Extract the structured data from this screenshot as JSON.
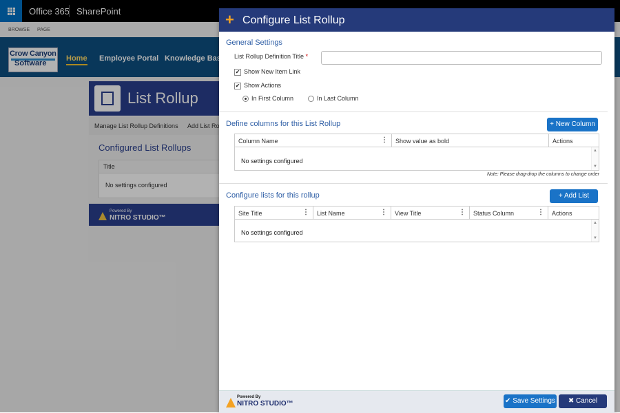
{
  "suitebar": {
    "brand": "Office 365",
    "app": "SharePoint"
  },
  "ribbon": {
    "tabs": [
      "BROWSE",
      "PAGE"
    ]
  },
  "logo": {
    "line1": "Crow Canyon",
    "line2": "Software"
  },
  "nav": {
    "items": [
      "Home",
      "Employee Portal",
      "Knowledge Base"
    ]
  },
  "page": {
    "banner_title": "List Rollup",
    "tabs": [
      "Manage List Rollup Definitions",
      "Add List Ro"
    ],
    "configured_title": "Configured List Rollups",
    "table_header": "Title",
    "empty": "No settings configured",
    "powered_by": "Powered By",
    "nitro": "NITRO STUDIO™"
  },
  "dialog": {
    "title": "Configure List Rollup",
    "general": {
      "heading": "General Settings",
      "title_label": "List Rollup Definition Title",
      "required_mark": "*",
      "title_value": "",
      "show_new_item_link": "Show New Item Link",
      "show_actions": "Show Actions",
      "in_first_column": "In First Column",
      "in_last_column": "In Last Column",
      "check_mark": "✔"
    },
    "columns": {
      "heading": "Define columns for this List Rollup",
      "new_button": "New Column",
      "headers": [
        "Column Name",
        "Show value as bold",
        "Actions"
      ],
      "empty": "No settings configured",
      "note": "Note: Please drag-drop the columns to change order"
    },
    "lists": {
      "heading": "Configure lists for this rollup",
      "add_button": "Add List",
      "headers": [
        "Site Title",
        "List Name",
        "View Title",
        "Status Column",
        "Actions"
      ],
      "empty": "No settings configured"
    },
    "footer": {
      "powered_by": "Powered By",
      "nitro": "NITRO STUDIO™",
      "save": "Save Settings",
      "cancel": "Cancel"
    }
  },
  "colors": {
    "accent": "#1a73c7",
    "header": "#253a7a",
    "plus": "#f4a223",
    "nav": "#0d4f82"
  },
  "icons": {
    "app_launcher": "waffle-icon",
    "plus": "plus-icon",
    "menu": "column-menu-icon",
    "check": "check-icon",
    "close": "close-icon"
  }
}
